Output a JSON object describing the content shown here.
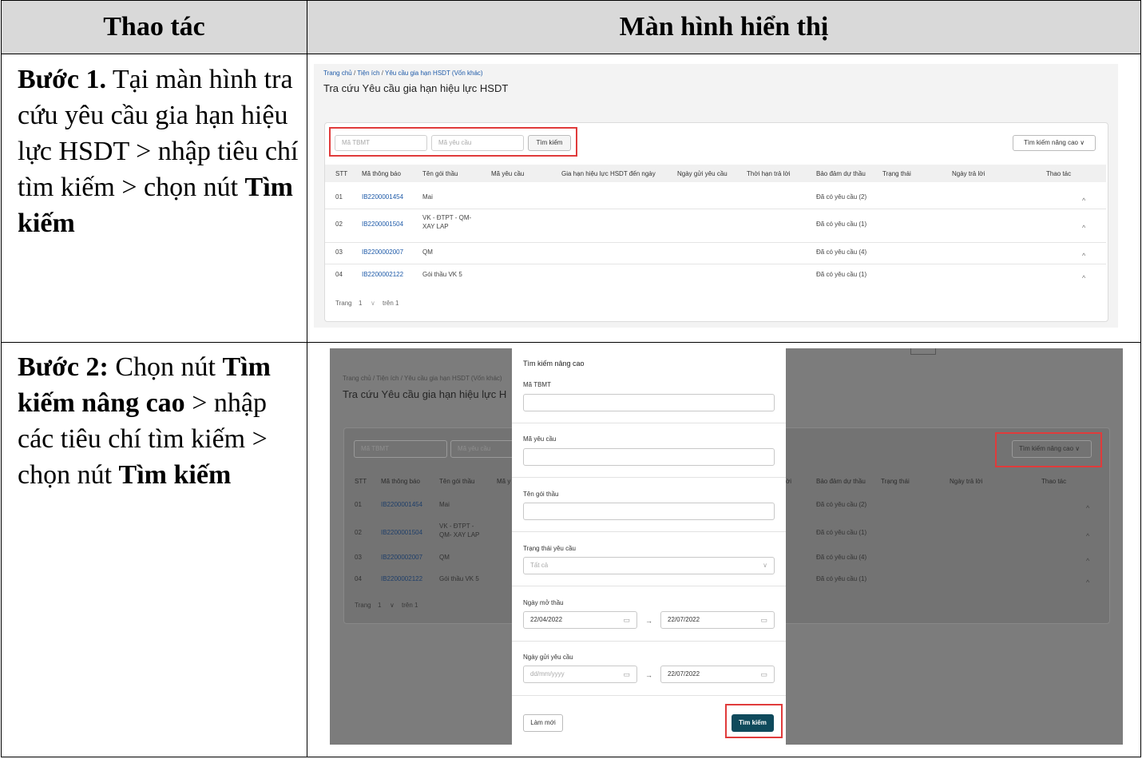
{
  "table": {
    "col1_header": "Thao tác",
    "col2_header": "Màn hình hiển thị"
  },
  "steps": [
    {
      "label": "Bước 1.",
      "text_1": "Tại màn hình tra cứu yêu cầu gia hạn hiệu lực HSDT > nhập tiêu chí tìm kiếm > chọn nút",
      "bold_1": "Tìm kiếm"
    },
    {
      "label": "Bước 2:",
      "text_1": "Chọn nút",
      "bold_1": "Tìm kiếm nâng cao",
      "text_2": "> nhập các tiêu chí tìm kiếm > chọn nút",
      "bold_2": "Tìm kiếm"
    }
  ],
  "screen": {
    "breadcrumb_home": "Trang chủ",
    "breadcrumb_util": "Tiện ích",
    "breadcrumb_current": "Yêu cầu gia hạn HSDT (Vốn khác)",
    "sep": "/",
    "title": "Tra cứu Yêu cầu gia hạn hiệu lực HSDT",
    "title_truncated": "Tra cứu Yêu cầu gia hạn hiệu lực H",
    "placeholder_tbmt": "Mã TBMT",
    "placeholder_request": "Mã yêu cầu",
    "search_btn": "Tìm kiếm",
    "advanced_btn": "Tìm kiếm nâng cao ∨",
    "columns": [
      "STT",
      "Mã thông báo",
      "Tên gói thầu",
      "Mã yêu cầu",
      "Gia hạn hiệu lực HSDT đến ngày",
      "Ngày gửi yêu cầu",
      "Thời hạn trả lời",
      "Bảo đảm dự thầu",
      "Trạng thái",
      "Ngày trả lời",
      "Thao tác"
    ],
    "columns_s2": [
      "STT",
      "Mã thông báo",
      "Tên gói thầu",
      "Mã y",
      "ời",
      "Bảo đảm dự thầu",
      "Trạng thái",
      "Ngày trả lời",
      "Thao tác"
    ],
    "rows": [
      {
        "stt": "01",
        "code": "IB2200001454",
        "name_1": "Mai",
        "name_2": "",
        "status": "Đã có yêu cầu (2)"
      },
      {
        "stt": "02",
        "code": "IB2200001504",
        "name_1": "VK - ĐTPT - QM-",
        "name_2": "XAY LAP",
        "status": "Đã có yêu cầu (1)"
      },
      {
        "stt": "03",
        "code": "IB2200002007",
        "name_1": "QM",
        "name_2": "",
        "status": "Đã có yêu cầu (4)"
      },
      {
        "stt": "04",
        "code": "IB2200002122",
        "name_1": "Gói thầu VK 5",
        "name_2": "",
        "status": "Đã có yêu cầu (1)"
      }
    ],
    "rows_s2_names": [
      {
        "name_1": "Mai",
        "name_2": ""
      },
      {
        "name_1": "VK - ĐTPT -",
        "name_2": "QM- XAY LAP"
      },
      {
        "name_1": "QM",
        "name_2": ""
      },
      {
        "name_1": "Gói thầu VK 5",
        "name_2": ""
      }
    ],
    "expand_icon": "^",
    "pager_label": "Trang",
    "pager_page": "1",
    "pager_dropdown": "∨",
    "pager_total": "trên 1"
  },
  "modal": {
    "title": "Tìm kiếm nâng cao",
    "label_tbmt": "Mã TBMT",
    "label_request": "Mã yêu cầu",
    "label_package": "Tên gói thầu",
    "label_status": "Trạng thái yêu cầu",
    "status_value": "Tất cả",
    "status_chevron": "∨",
    "label_open_date": "Ngày mở thầu",
    "open_from": "22/04/2022",
    "open_to": "22/07/2022",
    "label_sent_date": "Ngày gửi yêu cầu",
    "sent_from_placeholder": "dd/mm/yyyy",
    "sent_to": "22/07/2022",
    "range_arrow": "→",
    "calendar_icon": "▭",
    "reset_btn": "Làm mới",
    "search_btn": "Tìm kiếm"
  },
  "colors": {
    "link": "#1e5aa8",
    "highlight": "#e03b3b",
    "primary_button": "#0f4a5c",
    "header_bg": "#d9d9d9"
  }
}
